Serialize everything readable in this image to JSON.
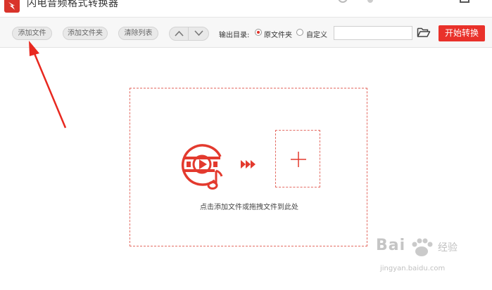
{
  "app": {
    "title": "闪电音频格式转换器"
  },
  "toolbar": {
    "add_file": "添加文件",
    "add_folder": "添加文件夹",
    "clear_list": "清除列表",
    "output_label": "输出目录:",
    "output_options": {
      "original": "原文件夹",
      "custom": "自定义",
      "selected": "original"
    },
    "output_path_value": "",
    "start_label": "开始转换"
  },
  "dropzone": {
    "hint": "点击添加文件或拖拽文件到此处"
  },
  "watermark": {
    "brand": "Bai",
    "text": "经验",
    "url": "jingyan.baidu.com"
  },
  "colors": {
    "accent": "#e9312a",
    "toolbar_bg": "#f7f7f7",
    "dashed_border": "#e36b62"
  },
  "icons": [
    "app-logo-icon",
    "chevron-up-icon",
    "chevron-down-icon",
    "folder-open-icon",
    "audio-video-icon",
    "fast-forward-icon",
    "plus-icon",
    "annotation-arrow"
  ]
}
